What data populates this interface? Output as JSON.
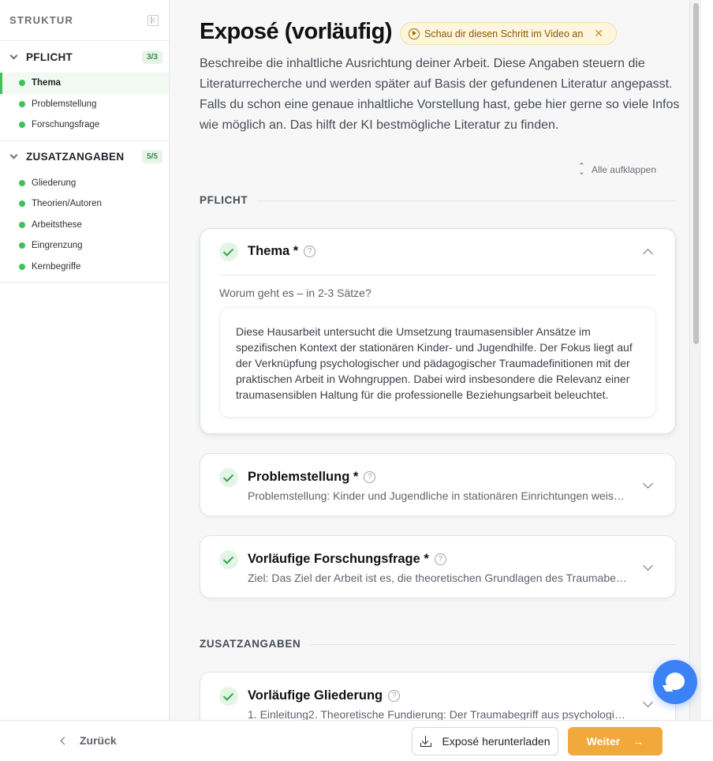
{
  "sidebar": {
    "title": "STRUKTUR",
    "sections": [
      {
        "title": "PFLICHT",
        "badge": "3/3",
        "items": [
          {
            "label": "Thema",
            "active": true
          },
          {
            "label": "Problemstellung"
          },
          {
            "label": "Forschungsfrage"
          }
        ]
      },
      {
        "title": "ZUSATZANGABEN",
        "badge": "5/5",
        "items": [
          {
            "label": "Gliederung"
          },
          {
            "label": "Theorien/Autoren"
          },
          {
            "label": "Arbeitsthese"
          },
          {
            "label": "Eingrenzung"
          },
          {
            "label": "Kernbegriffe"
          }
        ]
      }
    ]
  },
  "main": {
    "title": "Exposé (vorläufig)",
    "video_chip": "Schau dir diesen Schritt im Video an",
    "intro": "Beschreibe die inhaltliche Ausrichtung deiner Arbeit. Diese Angaben steuern die Literaturrecherche und werden später auf Basis der gefundenen Literatur angepasst. Falls du schon eine genaue inhaltliche Vorstellung hast, gebe hier gerne so viele Infos wie möglich an. Das hilft der KI bestmögliche Literatur zu finden.",
    "expand_all": "Alle aufklappen",
    "section_pflicht": "PFLICHT",
    "section_zusatz": "ZUSATZANGABEN",
    "cards": {
      "thema": {
        "title": "Thema *",
        "question": "Worum geht es – in 2-3 Sätze?",
        "answer": "Diese Hausarbeit untersucht die Umsetzung traumasensibler Ansätze im spezifischen Kontext der stationären Kinder- und Jugendhilfe. Der Fokus liegt auf der Verknüpfung psychologischer und pädagogischer Traumadefinitionen mit der praktischen Arbeit in Wohngruppen. Dabei wird insbesondere die Relevanz einer traumasensiblen Haltung für die professionelle Beziehungsarbeit beleuchtet."
      },
      "problem": {
        "title": "Problemstellung *",
        "summary": "Problemstellung: Kinder und Jugendliche in stationären Einrichtungen weisen häufig Traumaerfahrungen auf"
      },
      "frage": {
        "title": "Vorläufige Forschungsfrage *",
        "summary": "Ziel: Das Ziel der Arbeit ist es, die theoretischen Grundlagen des Traumabegriffs darzustellen"
      },
      "gliederung": {
        "title": "Vorläufige Gliederung",
        "summary": "1. Einleitung2. Theoretische Fundierung: Der Traumabegriff aus psychologischer Sicht"
      }
    }
  },
  "footer": {
    "back": "Zurück",
    "download": "Exposé herunterladen",
    "next": "Weiter"
  }
}
